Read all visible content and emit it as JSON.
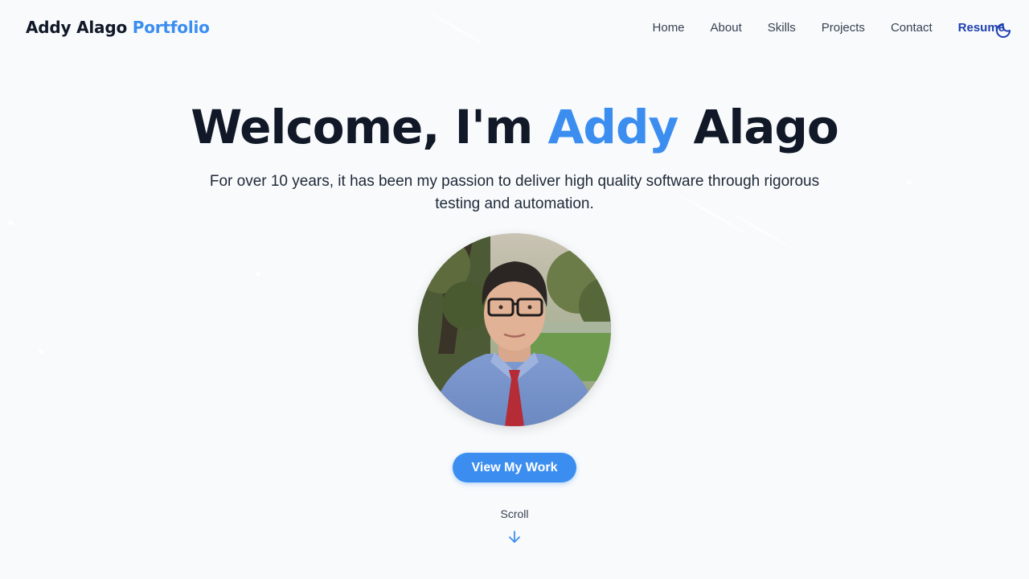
{
  "header": {
    "brand_name": "Addy Alago",
    "brand_accent": "Portfolio",
    "nav": [
      {
        "label": "Home"
      },
      {
        "label": "About"
      },
      {
        "label": "Skills"
      },
      {
        "label": "Projects"
      },
      {
        "label": "Contact"
      },
      {
        "label": "Resume"
      }
    ],
    "theme_toggle_icon": "moon-icon"
  },
  "hero": {
    "title_prefix": "Welcome, I'm",
    "title_accent": "Addy",
    "title_suffix": "Alago",
    "subtitle": "For over 10 years, it has been my passion to deliver high quality software through rigorous testing and automation.",
    "cta_label": "View My Work",
    "scroll_label": "Scroll",
    "scroll_icon": "arrow-down-icon"
  },
  "colors": {
    "accent": "#3b8ef0",
    "resume_link": "#1e40af",
    "text": "#111827",
    "background": "#f8fafc"
  }
}
